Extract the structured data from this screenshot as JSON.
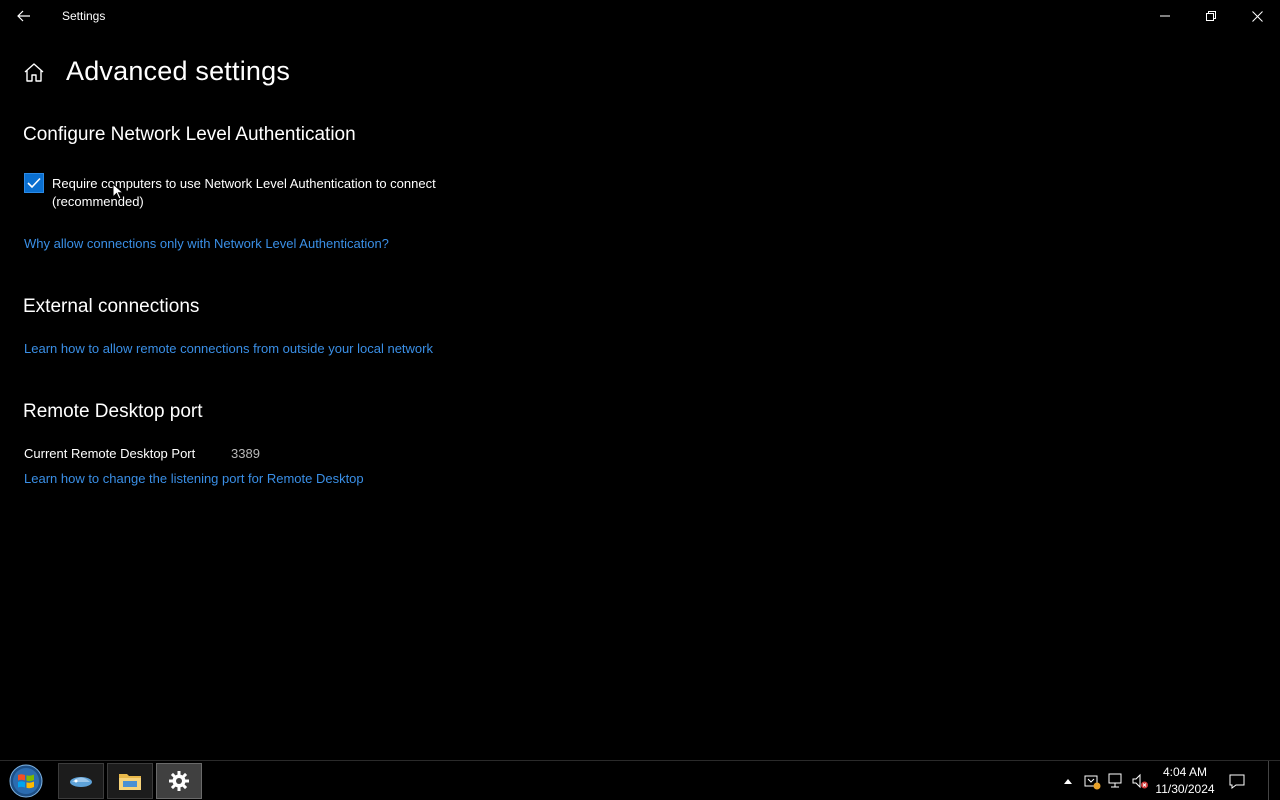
{
  "window": {
    "title": "Settings"
  },
  "page": {
    "title": "Advanced settings"
  },
  "nla": {
    "heading": "Configure Network Level Authentication",
    "checkbox_label": "Require computers to use Network Level Authentication to connect (recommended)",
    "checked": true,
    "link": "Why allow connections only with Network Level Authentication?"
  },
  "external": {
    "heading": "External connections",
    "link": "Learn how to allow remote connections from outside your local network"
  },
  "port": {
    "heading": "Remote Desktop port",
    "label": "Current Remote Desktop Port",
    "value": "3389",
    "link": "Learn how to change the listening port for Remote Desktop"
  },
  "taskbar": {
    "apps": [
      "remote-desktop-app-icon",
      "file-explorer-icon",
      "settings-gear-icon"
    ],
    "active_app": "settings-gear-icon",
    "clock_time": "4:04 AM",
    "clock_date": "11/30/2024"
  },
  "colors": {
    "accent": "#0a6fd0",
    "link": "#3a8fe6",
    "background": "#000000"
  }
}
